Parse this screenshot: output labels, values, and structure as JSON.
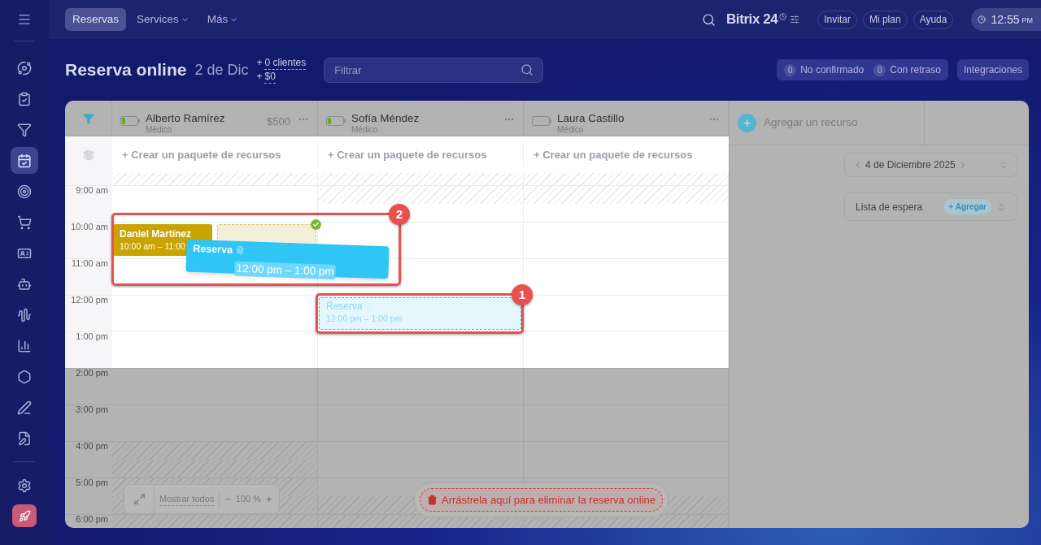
{
  "sidebar": {
    "items": [
      {
        "selected": false
      },
      {
        "selected": false
      },
      {
        "selected": false
      },
      {
        "selected": true
      },
      {
        "selected": false
      },
      {
        "selected": false
      },
      {
        "selected": false
      },
      {
        "selected": false
      },
      {
        "selected": false
      },
      {
        "selected": false
      },
      {
        "selected": false
      },
      {
        "selected": false
      },
      {
        "selected": false
      }
    ]
  },
  "top_nav": {
    "tabs": [
      {
        "label": "Reservas",
        "selected": true,
        "has_menu": false
      },
      {
        "label": "Services",
        "selected": false,
        "has_menu": true
      },
      {
        "label": "Más",
        "selected": false,
        "has_menu": true
      }
    ]
  },
  "brand": "Bitrix 24",
  "header_buttons": [
    "Invitar",
    "Mi plan",
    "Ayuda"
  ],
  "clock": {
    "time": "12:55",
    "period": "PM"
  },
  "page": {
    "title": "Reserva online",
    "date": "2 de Dic",
    "stats": [
      {
        "sign": "+",
        "value": "0 clientes"
      },
      {
        "sign": "+",
        "value": "$0"
      }
    ]
  },
  "filter": {
    "placeholder": "Filtrar"
  },
  "counters": [
    {
      "count": "0",
      "label": "No confirmado"
    },
    {
      "count": "0",
      "label": "Con retraso"
    }
  ],
  "integrations_button": "Integraciones",
  "resources": [
    {
      "name": "Alberto Ramírez",
      "role": "Médico",
      "price": "$500",
      "level": 0.2,
      "package_action": "+ Crear un paquete de recursos"
    },
    {
      "name": "Sofía Méndez",
      "role": "Médico",
      "level": 0.2,
      "package_action": "+ Crear un paquete de recursos"
    },
    {
      "name": "Laura Castillo",
      "role": "Médico",
      "level": 0,
      "package_action": "+ Crear un paquete de recursos"
    }
  ],
  "add_resource": "Agregar un recurso",
  "times": [
    {
      "label": "9:00 am",
      "blocked": [
        {
          "first_half": false,
          "second_half": false
        },
        {
          "first_half": true,
          "second_half": false
        },
        {
          "first_half": true,
          "second_half": false
        }
      ]
    },
    {
      "label": "10:00 am",
      "blocked": [
        {
          "first_half": false,
          "second_half": false
        },
        {
          "first_half": false,
          "second_half": false
        },
        {
          "first_half": false,
          "second_half": false
        }
      ]
    },
    {
      "label": "11:00 am",
      "blocked": [
        {
          "first_half": false,
          "second_half": false
        },
        {
          "first_half": false,
          "second_half": false
        },
        {
          "first_half": false,
          "second_half": false
        }
      ]
    },
    {
      "label": "12:00 pm",
      "blocked": [
        {
          "first_half": false,
          "second_half": false
        },
        {
          "first_half": false,
          "second_half": false
        },
        {
          "first_half": false,
          "second_half": false
        }
      ]
    },
    {
      "label": "1:00 pm",
      "blocked": [
        {
          "first_half": false,
          "second_half": false
        },
        {
          "first_half": false,
          "second_half": false
        },
        {
          "first_half": false,
          "second_half": false
        }
      ]
    },
    {
      "label": "2:00 pm",
      "blocked": [
        {
          "first_half": false,
          "second_half": false
        },
        {
          "first_half": false,
          "second_half": false
        },
        {
          "first_half": false,
          "second_half": false
        }
      ]
    },
    {
      "label": "3:00 pm",
      "blocked": [
        {
          "first_half": false,
          "second_half": false
        },
        {
          "first_half": false,
          "second_half": false
        },
        {
          "first_half": false,
          "second_half": false
        }
      ]
    },
    {
      "label": "4:00 pm",
      "blocked": [
        {
          "first_half": true,
          "second_half": true
        },
        {
          "first_half": false,
          "second_half": false
        },
        {
          "first_half": false,
          "second_half": false
        }
      ]
    },
    {
      "label": "5:00 pm",
      "blocked": [
        {
          "first_half": true,
          "second_half": true
        },
        {
          "first_half": false,
          "second_half": true
        },
        {
          "first_half": false,
          "second_half": true
        }
      ]
    },
    {
      "label": "6:00 pm",
      "blocked": [
        {
          "first_half": true
        },
        {
          "first_half": true
        },
        {
          "first_half": true
        }
      ]
    }
  ],
  "events": [
    {
      "kind": "booking",
      "title": "Daniel Martínez",
      "time": "10:00 am – 11:00"
    },
    {
      "kind": "drop_target"
    },
    {
      "kind": "ghost",
      "title": "Reserva",
      "time": "12:00 pm – 1:00 pm"
    },
    {
      "kind": "dragging",
      "title": "Reserva",
      "time": "12:00 pm – 1:00 pm"
    }
  ],
  "annotations": [
    {
      "number": "2"
    },
    {
      "number": "1"
    }
  ],
  "date_picker": "4 de Diciembre 2025",
  "waitlist": {
    "label": "Lista de espera",
    "action": "+ Agregar"
  },
  "zoom_control": {
    "show_all": "Mostrar todos",
    "minus": "−",
    "value": "100 %",
    "plus": "+"
  },
  "delete_zone": "Arrástrela aquí para eliminar la reserva online"
}
